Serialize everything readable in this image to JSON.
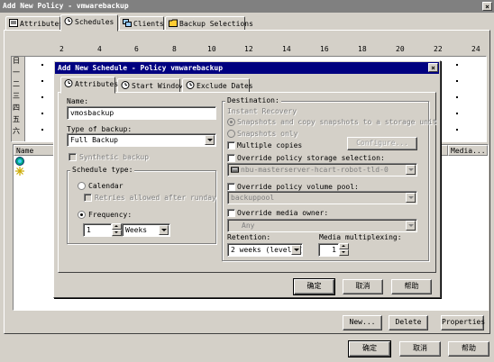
{
  "policy_window": {
    "title": "Add New Policy - vmwarebackup",
    "tabs": [
      {
        "label": "Attributes",
        "icon": "attributes-icon"
      },
      {
        "label": "Schedules",
        "icon": "schedules-icon"
      },
      {
        "label": "Clients",
        "icon": "clients-icon"
      },
      {
        "label": "Backup Selections",
        "icon": "folder-icon"
      }
    ],
    "selected_tab": "Schedules",
    "hours": [
      "2",
      "4",
      "6",
      "8",
      "10",
      "12",
      "14",
      "16",
      "18",
      "20",
      "22",
      "24"
    ],
    "days": [
      "日",
      "一",
      "二",
      "三",
      "四",
      "五",
      "六"
    ],
    "list_columns": {
      "name": "Name",
      "media": "Media..."
    },
    "buttons": {
      "new": "New...",
      "delete": "Delete",
      "properties": "Properties"
    },
    "footer_buttons": {
      "ok": "确定",
      "cancel": "取消",
      "help": "帮助"
    }
  },
  "schedule_dialog": {
    "title": "Add New Schedule - Policy vmwarebackup",
    "tabs": [
      {
        "label": "Attributes",
        "icon": "attributes-icon"
      },
      {
        "label": "Start Window",
        "icon": "clock-icon"
      },
      {
        "label": "Exclude Dates",
        "icon": "calendar-icon"
      }
    ],
    "selected_tab": "Attributes",
    "name_label": "Name:",
    "name_value": "vmosbackup",
    "backup_type_label": "Type of backup:",
    "backup_type_value": "Full Backup",
    "synthetic_backup_label": "Synthetic backup",
    "schedule_type_label": "Schedule type:",
    "calendar_label": "Calendar",
    "retries_label": "Retries allowed after runday",
    "frequency_label": "Frequency:",
    "frequency_value": "1",
    "frequency_unit": "Weeks",
    "destination_label": "Destination:",
    "instant_recovery_label": "Instant Recovery",
    "snap_copy_label": "Snapshots and copy snapshots to a storage unit",
    "snap_only_label": "Snapshots only",
    "multiple_copies_label": "Multiple copies",
    "configure_button": "Configure...",
    "override_storage_label": "Override policy storage selection:",
    "storage_value": "nbu-masterserver-hcart-robot-tld-0",
    "override_volume_label": "Override policy volume pool:",
    "volume_value": "backuppool",
    "override_media_label": "Override media owner:",
    "media_owner_value": "Any",
    "retention_label": "Retention:",
    "retention_value": "2 weeks (level 1)",
    "multiplexing_label": "Media multiplexing:",
    "multiplexing_value": "1",
    "ok": "确定",
    "cancel": "取消",
    "help": "帮助"
  }
}
